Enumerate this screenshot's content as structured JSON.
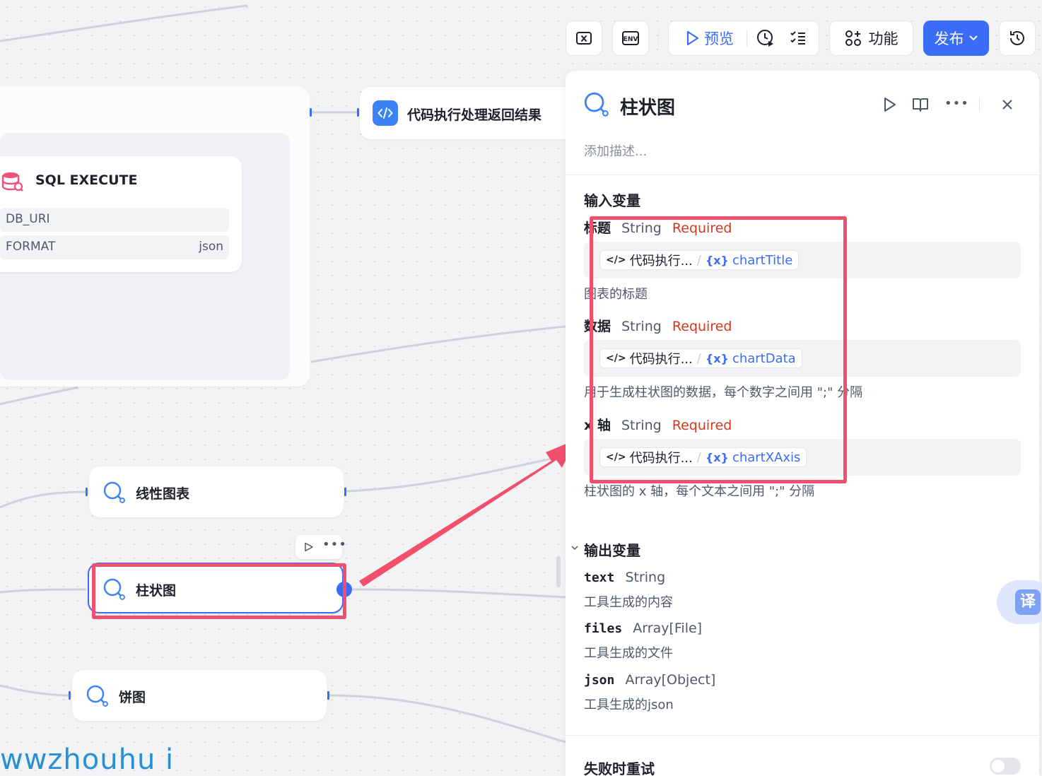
{
  "toolbar": {
    "preview_label": "预览",
    "features_label": "功能",
    "publish_label": "发布",
    "brand_color": "#3b6cf6"
  },
  "canvas": {
    "code_node_title": "代码执行处理返回结果",
    "sql_node": {
      "title": "SQL EXECUTE",
      "params": [
        {
          "name": "DB_URI",
          "value": ""
        },
        {
          "name": "FORMAT",
          "value": "json"
        }
      ]
    },
    "line_chart_title": "线性图表",
    "bar_chart_title": "柱状图",
    "pie_chart_title": "饼图",
    "watermark": "wwzhouhu i"
  },
  "panel": {
    "title": "柱状图",
    "description_placeholder": "添加描述...",
    "inputs_heading": "输入变量",
    "inputs": [
      {
        "name": "标题",
        "type": "String",
        "required": "Required",
        "source": "代码执行...",
        "variable": "chartTitle",
        "description": "图表的标题"
      },
      {
        "name": "数据",
        "type": "String",
        "required": "Required",
        "source": "代码执行...",
        "variable": "chartData",
        "description": "用于生成柱状图的数据，每个数字之间用 \";\" 分隔"
      },
      {
        "name": "x 轴",
        "type": "String",
        "required": "Required",
        "source": "代码执行...",
        "variable": "chartXAxis",
        "description": "柱状图的 x 轴，每个文本之间用 \";\" 分隔"
      }
    ],
    "outputs_heading": "输出变量",
    "outputs": [
      {
        "name": "text",
        "type": "String",
        "description": "工具生成的内容"
      },
      {
        "name": "files",
        "type": "Array[File]",
        "description": "工具生成的文件"
      },
      {
        "name": "json",
        "type": "Array[Object]",
        "description": "工具生成的json"
      }
    ],
    "retry_label": "失败时重试",
    "translate_label": "译"
  }
}
